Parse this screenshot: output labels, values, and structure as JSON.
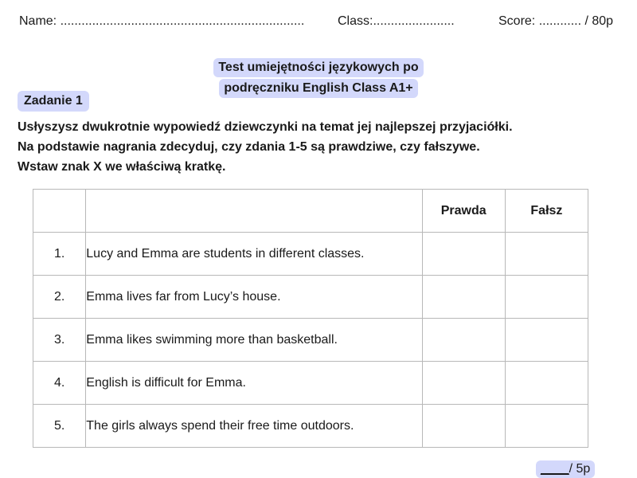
{
  "header": {
    "name_label": "Name: .....................................................................",
    "class_label": "Class:.......................",
    "score_label": "Score: ............ / 80p"
  },
  "title": {
    "line1": "Test umiejętności językowych po",
    "line2": "podręczniku English Class A1+"
  },
  "task": {
    "label": "Zadanie 1",
    "instructions": [
      "Usłyszysz dwukrotnie wypowiedź dziewczynki na temat jej najlepszej przyjaciółki.",
      "Na podstawie nagrania zdecyduj, czy zdania 1-5 są prawdziwe, czy fałszywe.",
      "Wstaw znak X we właściwą kratkę."
    ]
  },
  "table": {
    "headers": {
      "number": "",
      "statement": "",
      "true": "Prawda",
      "false": "Fałsz"
    },
    "rows": [
      {
        "num": "1.",
        "text": "Lucy and Emma are students in different classes.",
        "true": "",
        "false": ""
      },
      {
        "num": "2.",
        "text": "Emma lives far from Lucy’s house.",
        "true": "",
        "false": ""
      },
      {
        "num": "3.",
        "text": "Emma likes swimming more than basketball.",
        "true": "",
        "false": ""
      },
      {
        "num": "4.",
        "text": "English is difficult for Emma.",
        "true": "",
        "false": ""
      },
      {
        "num": "5.",
        "text": "The girls always spend their free time outdoors.",
        "true": "",
        "false": ""
      }
    ]
  },
  "points": {
    "blank": "____",
    "max": "/ 5p"
  }
}
